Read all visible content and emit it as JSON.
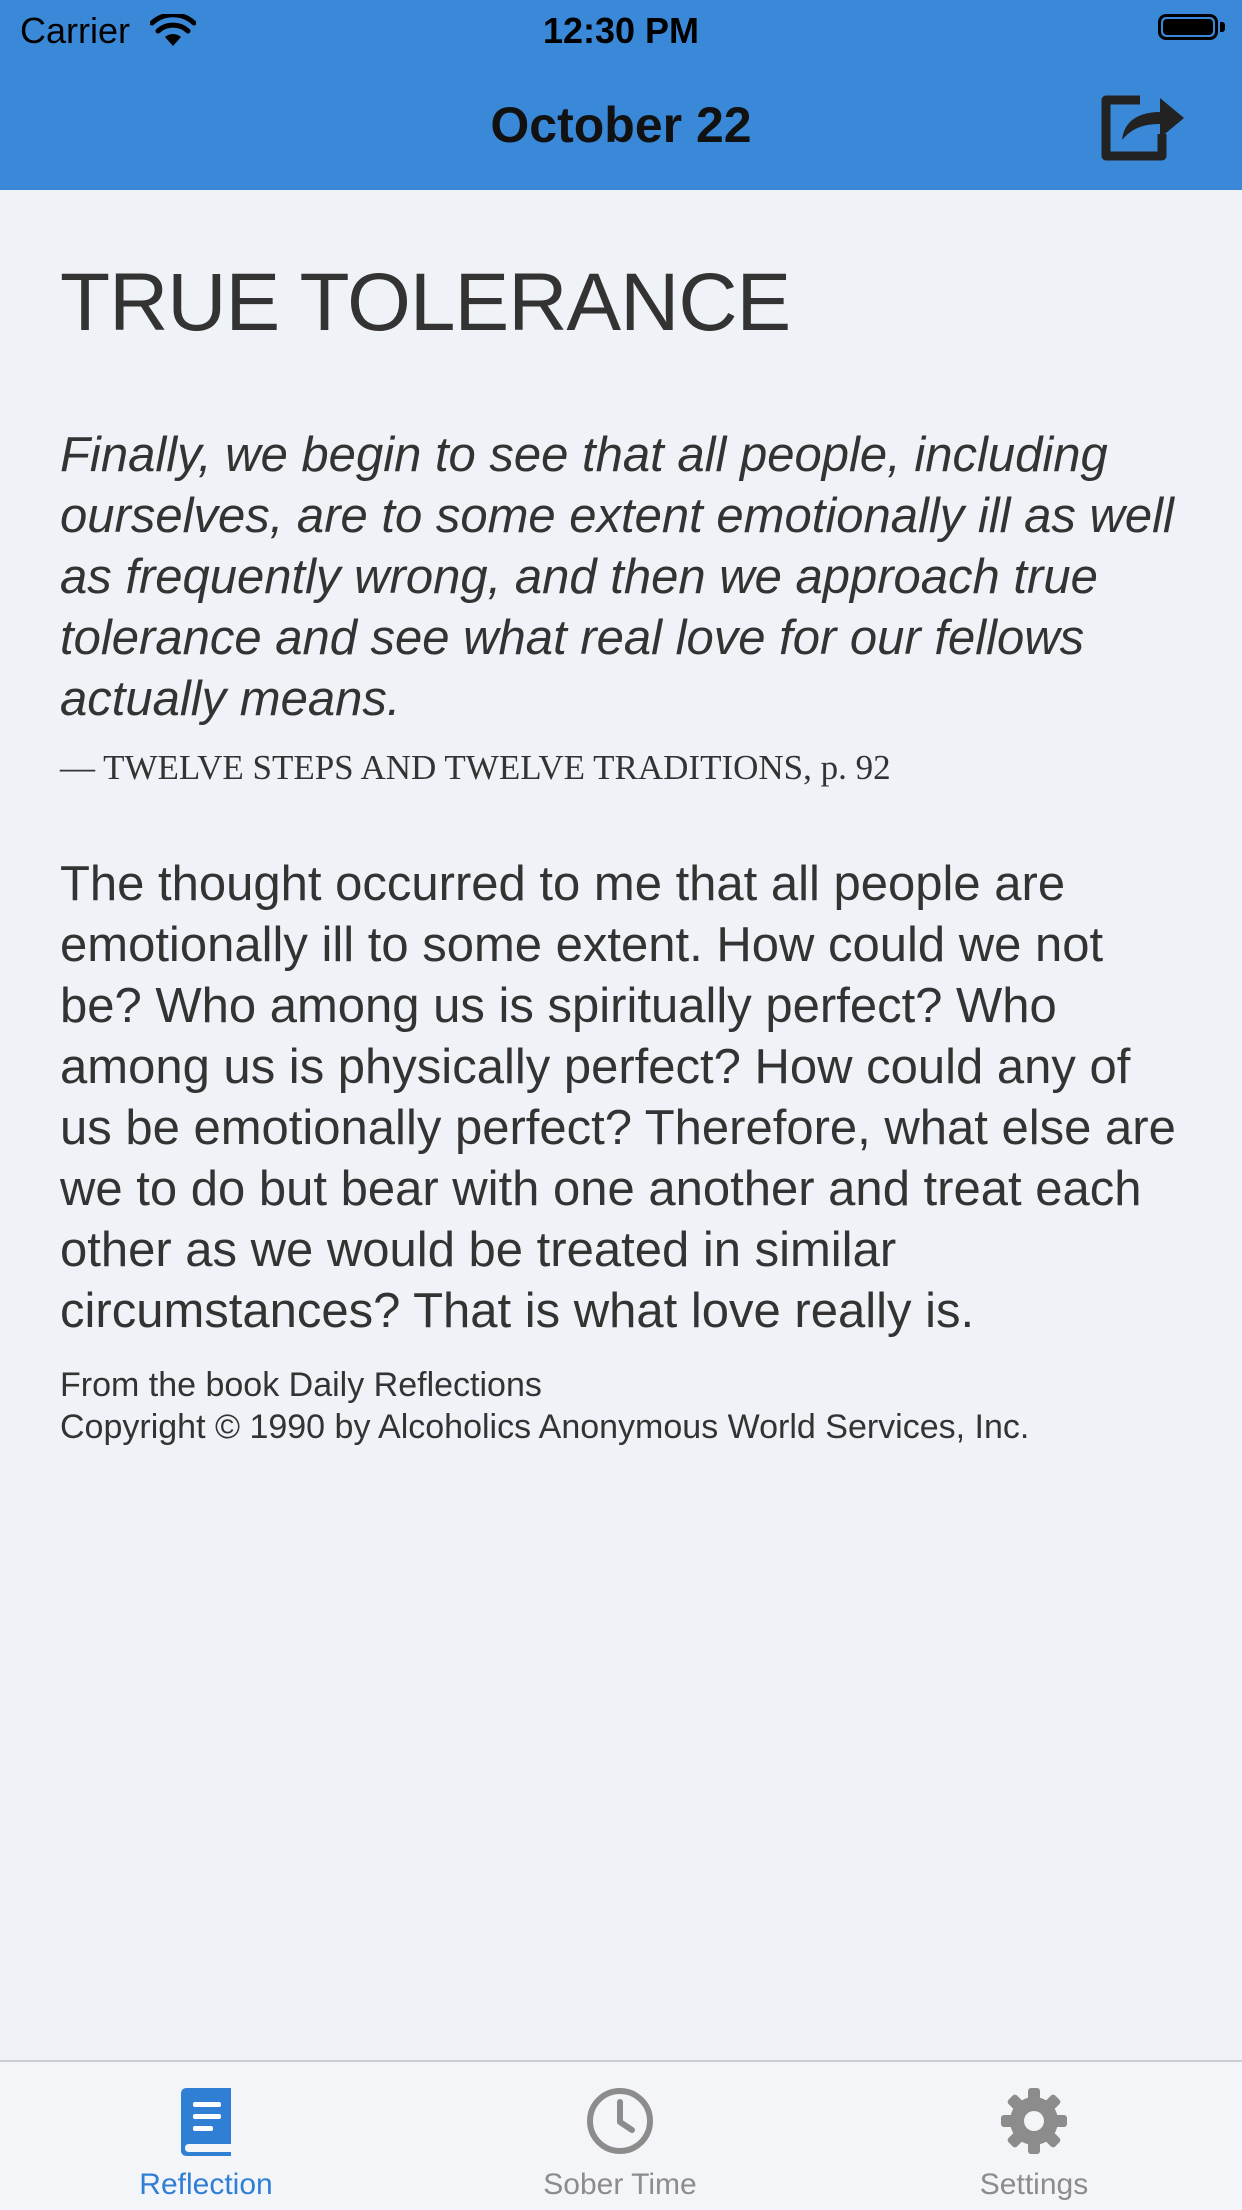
{
  "status_bar": {
    "carrier": "Carrier",
    "time": "12:30 PM"
  },
  "nav": {
    "title": "October 22",
    "share_icon": "share-icon"
  },
  "reading": {
    "title": "TRUE TOLERANCE",
    "quote": "Finally, we begin to see that all people, including ourselves, are to some extent emotionally ill as well as frequently wrong, and then we approach true tolerance and see what real love for our fellows actually means.",
    "source": "— TWELVE STEPS AND TWELVE TRADITIONS, p. 92",
    "body": "The thought occurred to me that all people are emotionally ill to some extent. How could we not be? Who among us is spiritually perfect? Who among us is physically perfect? How could any of us be emotionally perfect? Therefore, what else are we to do but bear with one another and treat each other as we would be treated in similar circumstances? That is what love really is.",
    "credit_line1": "From the book Daily Reflections",
    "credit_line2": "Copyright © 1990 by Alcoholics Anonymous World Services, Inc."
  },
  "tabs": [
    {
      "label": "Reflection",
      "icon": "book-icon",
      "active": true
    },
    {
      "label": "Sober Time",
      "icon": "clock-icon",
      "active": false
    },
    {
      "label": "Settings",
      "icon": "gear-icon",
      "active": false
    }
  ],
  "colors": {
    "header": "#3a89d9",
    "background": "#eff2f6",
    "tab_active": "#2f7fd5",
    "tab_inactive": "#8c8c8c"
  }
}
